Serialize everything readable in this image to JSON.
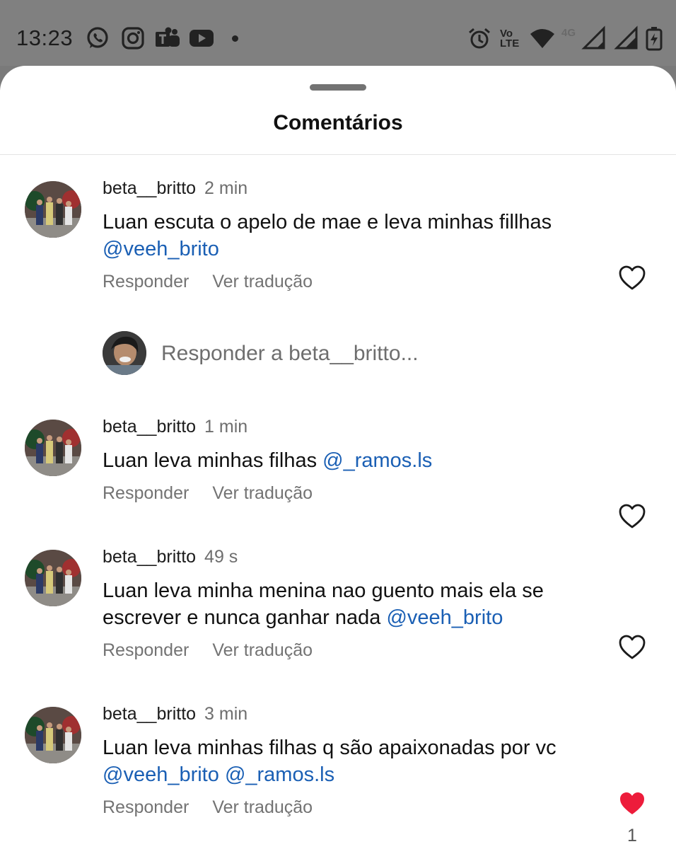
{
  "status_bar": {
    "time": "13:23",
    "app_icons": [
      "whatsapp-icon",
      "instagram-icon",
      "teams-icon",
      "youtube-icon"
    ],
    "indicators": [
      "alarm-icon",
      "volte-icon",
      "wifi-icon",
      "signal-4g-icon",
      "signal-icon",
      "battery-icon"
    ],
    "volte_line1": "Vo",
    "volte_line2": "LTE",
    "network_label": "4G"
  },
  "sheet": {
    "title": "Comentários"
  },
  "comments": [
    {
      "username": "beta__britto",
      "time": "2 min",
      "text": "Luan escuta o apelo de mae e leva minhas fillhas ",
      "mentions": [
        "@veeh_brito"
      ],
      "reply_label": "Responder",
      "translate_label": "Ver tradução",
      "liked": false
    },
    {
      "username": "beta__britto",
      "time": "1 min",
      "text": "Luan leva minhas filhas ",
      "mentions": [
        "@_ramos.ls"
      ],
      "reply_label": "Responder",
      "translate_label": "Ver tradução",
      "liked": false
    },
    {
      "username": "beta__britto",
      "time": "49 s",
      "text": "Luan leva minha menina nao guento mais ela se escrever e nunca ganhar nada ",
      "mentions": [
        "@veeh_brito"
      ],
      "reply_label": "Responder",
      "translate_label": "Ver tradução",
      "liked": false
    },
    {
      "username": "beta__britto",
      "time": "3 min",
      "text": "Luan leva minhas filhas q são apaixonadas por vc ",
      "mentions": [
        "@veeh_brito",
        "@_ramos.ls"
      ],
      "reply_label": "Responder",
      "translate_label": "Ver tradução",
      "liked": true,
      "like_count": "1"
    }
  ],
  "reply_composer": {
    "placeholder": "Responder a beta__britto..."
  },
  "colors": {
    "mention": "#1a5fb4",
    "liked_heart": "#ed1c3b",
    "muted_text": "#737373"
  }
}
